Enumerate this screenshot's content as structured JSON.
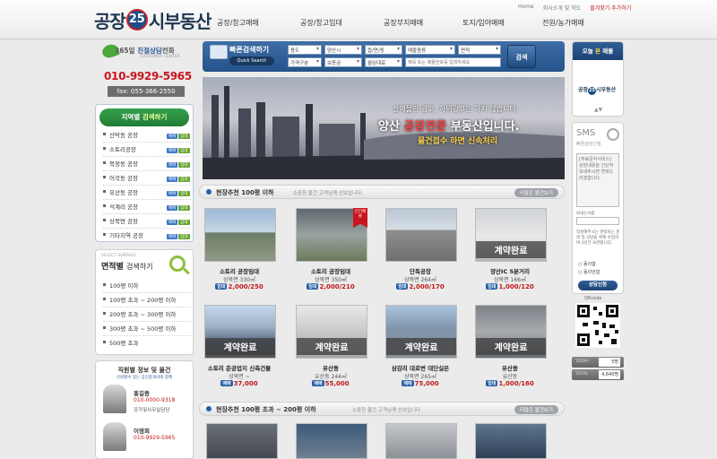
{
  "site": {
    "logo_left": "공장",
    "logo_num": "25",
    "logo_right": "시부동산"
  },
  "util_links": [
    "Home",
    "회사소개 및 약도",
    "즐겨찾기 추가하기"
  ],
  "gnb": [
    "공장/창고매매",
    "공장/창고임대",
    "공장부지매매",
    "토지/임야매매",
    "전원/농가매매"
  ],
  "phone_box": {
    "title_pre": "365일",
    "title_em": "친절상담",
    "title_post": "전화",
    "subtitle": "CUSTOMER CENTER",
    "phone": "010-9929-5965",
    "fax": "fax: 055-366-2550"
  },
  "region_box": {
    "title_pre": "지역별",
    "title_em": "검색하기",
    "items": [
      "산막동 공장",
      "소토리공장",
      "북정동 공장",
      "어곡동 공장",
      "유산동 공장",
      "석계리 공장",
      "상북면 공장",
      "기타지역 공장"
    ],
    "tag_labels": [
      "매매",
      "임대"
    ]
  },
  "area_box": {
    "eyebrow": "SELECT SURFACE",
    "title_pre": "면적별",
    "title_post": "검색하기",
    "items": [
      "100평 이하",
      "100평 초과 ~ 200평 이하",
      "200평 초과 ~ 300평 이하",
      "300평 초과 ~ 500평 이하",
      "500평 초과"
    ]
  },
  "staff_box": {
    "title": "직원별 정보 및 물건",
    "subtitle": "신뢰할수 있는 공인중개사와 함께",
    "staff": [
      {
        "name": "홍길동",
        "phone": "010-0000-9318",
        "role": "공가및사무실담당"
      },
      {
        "name": "이영희",
        "phone": "010-9929-5965",
        "role": ""
      }
    ]
  },
  "quick_search": {
    "title": "빠른검색하기",
    "button_sub": "Quick Search",
    "row1": [
      "용도",
      "양산시",
      "읍/면/동",
      "매물종류",
      "면적"
    ],
    "row2": [
      "가격구분",
      "보증금",
      "월임대료"
    ],
    "keyword_placeholder": "제목 또는 매물번호를 입력하세요",
    "search_button": "검색"
  },
  "banner": {
    "line1": "실매물만 광고, 허위광고는 하지 않습니다.",
    "line2_pre": "양산",
    "line2_em": "공장전문",
    "line2_post": "부동산입니다.",
    "line3": "물건접수 하면 신속처리"
  },
  "section1": {
    "title": "현장추천 100평 이하",
    "desc": "소중한 물건 고객님께 선보입니다.",
    "more": "더많은 물건보기"
  },
  "section2": {
    "title": "현장추천 100평 초과 ~ 200평 이하",
    "desc": "소중한 물건 고객님께 선보입니다.",
    "more": "더많은 물건보기"
  },
  "listings_row1": [
    {
      "name": "소토리 공장임대",
      "area": "상북면 330㎡",
      "price": "2,000/250",
      "badge": "임대",
      "done": ""
    },
    {
      "name": "소토리 공장임대",
      "area": "상북면 350㎡",
      "price": "2,000/210",
      "badge": "임대",
      "done": "",
      "ribbon": "인기매물"
    },
    {
      "name": "단독공장",
      "area": "상북면 264㎡",
      "price": "2,000/170",
      "badge": "임대",
      "done": ""
    },
    {
      "name": "양산IC 5분거리",
      "area": "상북면 166㎡",
      "price": "1,000/120",
      "badge": "임대",
      "done": "계약완료"
    }
  ],
  "listings_row2": [
    {
      "name": "소토리 준공업지 신축건물",
      "area": "상북면 ~",
      "price": "37,000",
      "badge": "매매",
      "done": "계약완료"
    },
    {
      "name": "유산동",
      "area": "유산동 244㎡",
      "price": "55,000",
      "badge": "매매",
      "done": "계약완료"
    },
    {
      "name": "삼감리 대로변 대단실은",
      "area": "상북면 265㎡",
      "price": "75,000",
      "badge": "매매",
      "done": "계약완료"
    },
    {
      "name": "유산동",
      "area": "유산동",
      "price": "1,000/160",
      "badge": "임대",
      "done": "계약완료"
    }
  ],
  "today_box": {
    "title_pre": "오늘",
    "title_em": "본",
    "title_post": "매물",
    "logo_left": "공장",
    "logo_num": "25",
    "logo_right": "시부동산"
  },
  "sms_box": {
    "title": "SMS",
    "subtitle": "빠른상담신청",
    "placeholder": "[무료문자서비스] 상담내용을 간단히 보내주시면 연락드리겠습니다.",
    "phone_label": "보내는사람",
    "notice": "작성해주시는 연락처는 문의 및 상담을 위해 수집하며 1년간 보관합니다.",
    "agree": "동의함",
    "disagree": "동의안함",
    "button": "상담신청"
  },
  "qr_label": "QRcode",
  "stats": [
    {
      "label": "TODAY",
      "value": "5명"
    },
    {
      "label": "TOTAL",
      "value": "4,640명"
    }
  ],
  "colors": {
    "brand_blue": "#1d4275",
    "accent_red": "#c01919",
    "section_blue": "#2560a6"
  }
}
